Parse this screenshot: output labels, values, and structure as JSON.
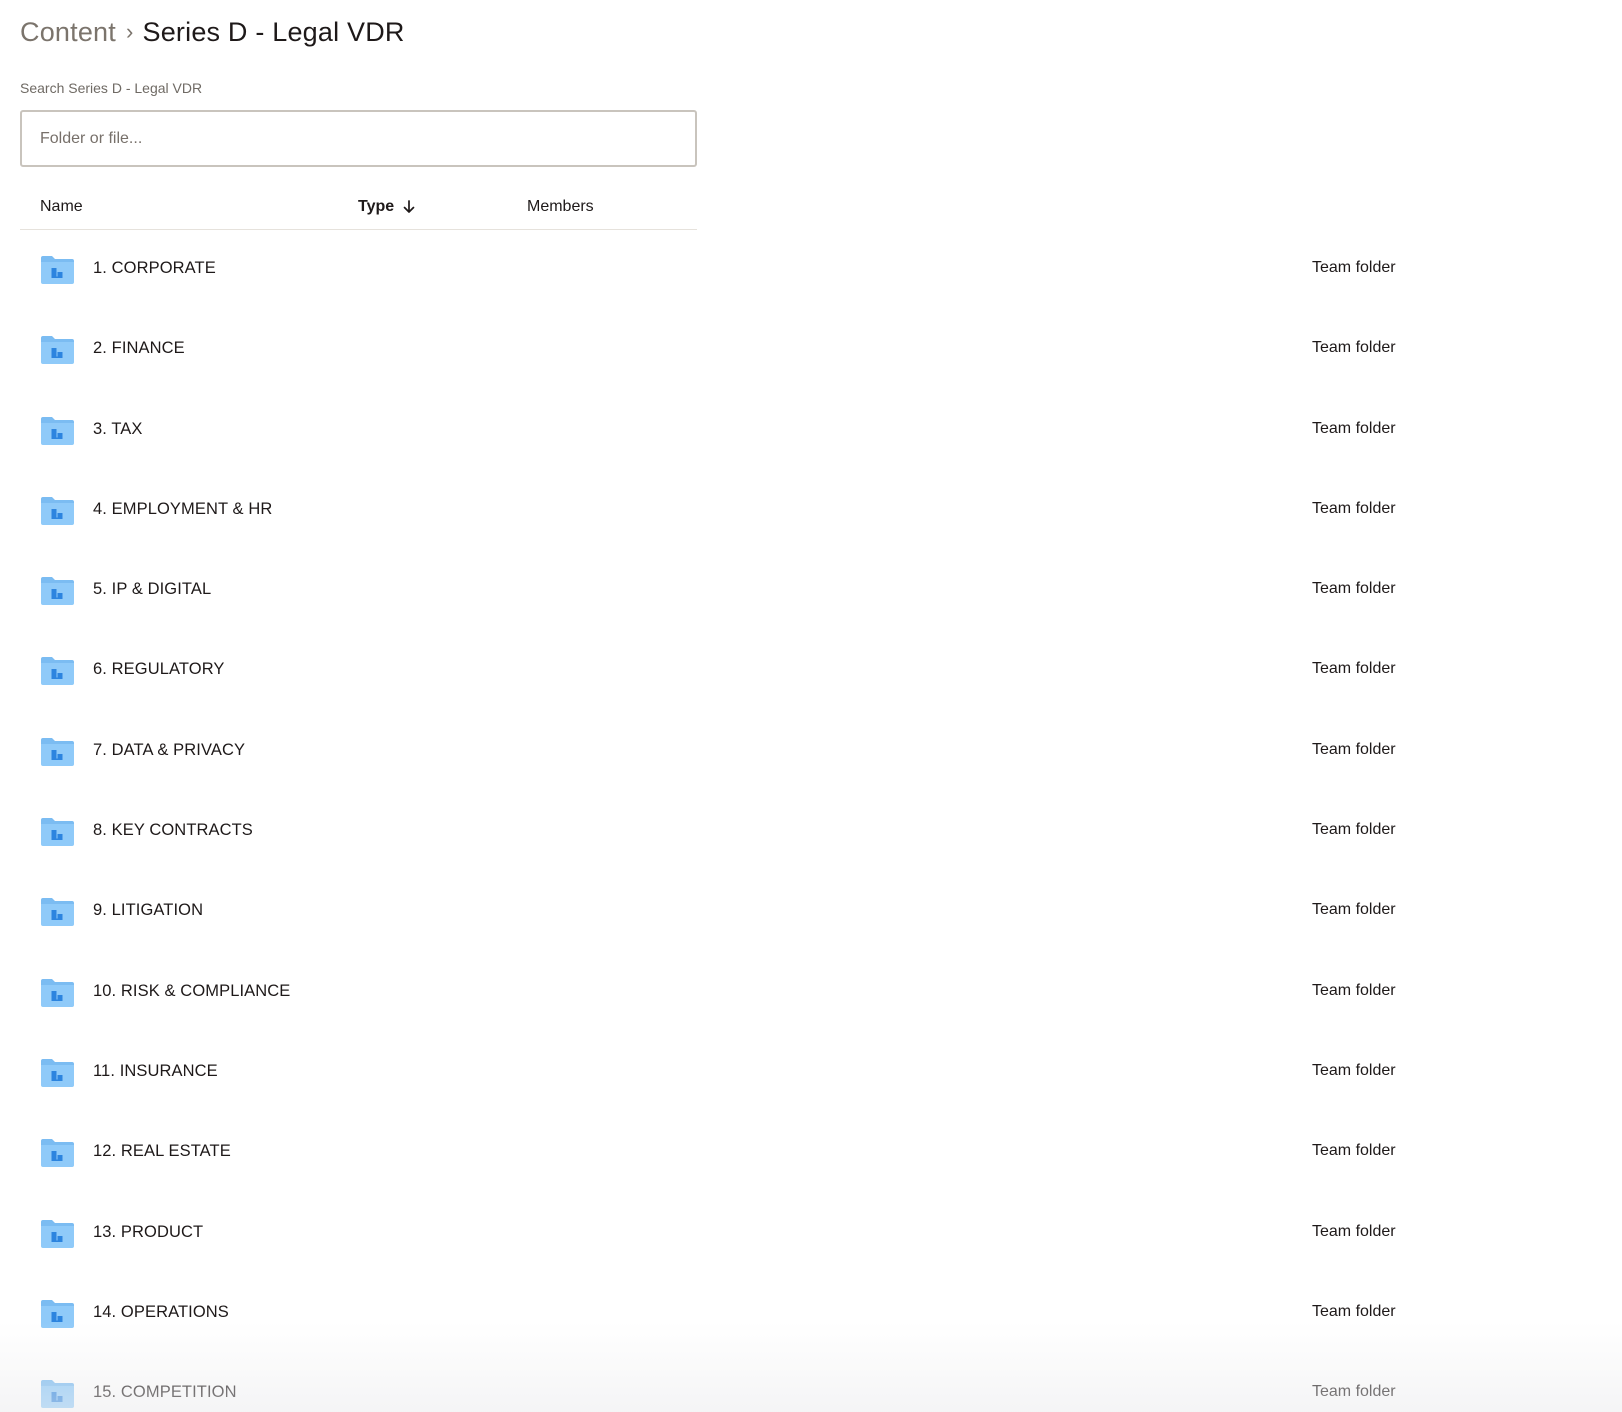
{
  "breadcrumb": {
    "root": "Content",
    "separator": "›",
    "current": "Series D - Legal VDR"
  },
  "search": {
    "label": "Search Series D - Legal VDR",
    "placeholder": "Folder or file...",
    "value": ""
  },
  "table": {
    "columns": {
      "name": "Name",
      "type": "Type",
      "members": "Members"
    },
    "sort": {
      "column": "type",
      "direction": "descending",
      "icon": "arrow-down-icon"
    },
    "rows": [
      {
        "name": "1. CORPORATE",
        "type": "Team folder",
        "icon": "team-folder-icon"
      },
      {
        "name": "2. FINANCE",
        "type": "Team folder",
        "icon": "team-folder-icon"
      },
      {
        "name": "3. TAX",
        "type": "Team folder",
        "icon": "team-folder-icon"
      },
      {
        "name": "4. EMPLOYMENT & HR",
        "type": "Team folder",
        "icon": "team-folder-icon"
      },
      {
        "name": "5. IP & DIGITAL",
        "type": "Team folder",
        "icon": "team-folder-icon"
      },
      {
        "name": "6. REGULATORY",
        "type": "Team folder",
        "icon": "team-folder-icon"
      },
      {
        "name": "7. DATA & PRIVACY",
        "type": "Team folder",
        "icon": "team-folder-icon"
      },
      {
        "name": "8. KEY CONTRACTS",
        "type": "Team folder",
        "icon": "team-folder-icon"
      },
      {
        "name": "9. LITIGATION",
        "type": "Team folder",
        "icon": "team-folder-icon"
      },
      {
        "name": "10. RISK & COMPLIANCE",
        "type": "Team folder",
        "icon": "team-folder-icon"
      },
      {
        "name": "11. INSURANCE",
        "type": "Team folder",
        "icon": "team-folder-icon"
      },
      {
        "name": "12. REAL ESTATE",
        "type": "Team folder",
        "icon": "team-folder-icon"
      },
      {
        "name": "13. PRODUCT",
        "type": "Team folder",
        "icon": "team-folder-icon"
      },
      {
        "name": "14. OPERATIONS",
        "type": "Team folder",
        "icon": "team-folder-icon"
      },
      {
        "name": "15. COMPETITION",
        "type": "Team folder",
        "icon": "team-folder-icon"
      }
    ]
  },
  "colors": {
    "folder_body": "#8fcaf9",
    "folder_tab": "#7bbcf2",
    "folder_mark": "#2c84df",
    "text_primary": "#1e1919",
    "text_muted": "#7b746c",
    "border": "#c9c4bd"
  }
}
